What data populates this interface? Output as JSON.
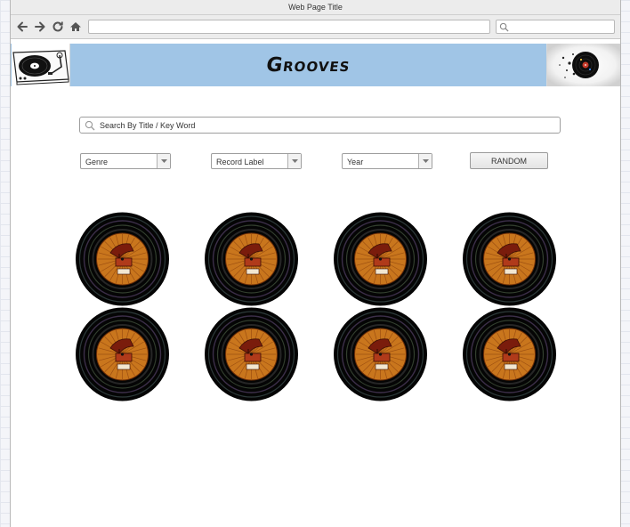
{
  "browser": {
    "title": "Web Page Title",
    "url": "",
    "search_value": "",
    "nav_icons": [
      "back-arrow-icon",
      "forward-arrow-icon",
      "reload-icon",
      "home-icon"
    ]
  },
  "banner": {
    "title": "Grooves",
    "background_color": "#a0c5e6",
    "left_logo": "turntable-icon",
    "right_logo": "vinyl-record-splash-icon"
  },
  "search": {
    "placeholder": "Search By Title / Key Word",
    "value": ""
  },
  "filters": [
    {
      "label": "Genre"
    },
    {
      "label": "Record Label"
    },
    {
      "label": "Year"
    }
  ],
  "random_button": {
    "label": "RANDOM"
  },
  "records": {
    "icon": "vinyl-record-gramophone-label-icon",
    "label_color": "#c9761d",
    "items": [
      {},
      {},
      {},
      {},
      {},
      {},
      {},
      {}
    ]
  }
}
